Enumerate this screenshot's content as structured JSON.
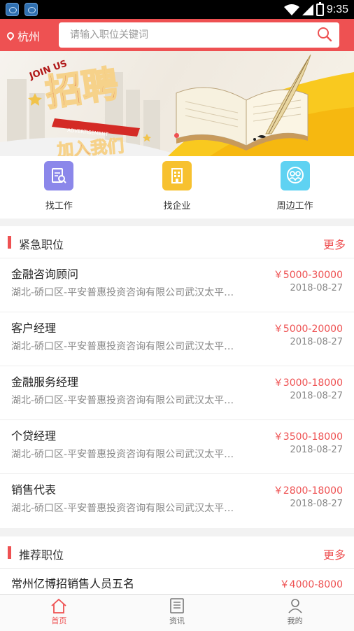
{
  "status_bar": {
    "time": "9:35",
    "app_icons": [
      "app-notification-icon",
      "app-notification-icon"
    ]
  },
  "header": {
    "city": "杭州",
    "search_placeholder": "请输入职位关键词",
    "accent_color": "#ee5152"
  },
  "banner": {
    "headline": "招聘",
    "subline": "加入我们",
    "ribbon_text": "ADVERTISEMENT",
    "small_text": "JOIN US",
    "slide_count": 1,
    "active_slide": 1
  },
  "quick_actions": [
    {
      "label": "找工作",
      "icon": "document-search-icon",
      "color": "#8b87ea"
    },
    {
      "label": "找企业",
      "icon": "building-icon",
      "color": "#f7c12f"
    },
    {
      "label": "周边工作",
      "icon": "nearby-people-icon",
      "color": "#5fd2f2"
    }
  ],
  "urgent": {
    "title": "紧急职位",
    "more": "更多",
    "jobs": [
      {
        "title": "金融咨询顾问",
        "company": "湖北-硚口区-平安普惠投资咨询有限公司武汉太平洋分公司",
        "salary": "￥5000-30000",
        "date": "2018-08-27"
      },
      {
        "title": "客户经理",
        "company": "湖北-硚口区-平安普惠投资咨询有限公司武汉太平洋分公司",
        "salary": "￥5000-20000",
        "date": "2018-08-27"
      },
      {
        "title": "金融服务经理",
        "company": "湖北-硚口区-平安普惠投资咨询有限公司武汉太平洋分公司",
        "salary": "￥3000-18000",
        "date": "2018-08-27"
      },
      {
        "title": "个贷经理",
        "company": "湖北-硚口区-平安普惠投资咨询有限公司武汉太平洋分公司",
        "salary": "￥3500-18000",
        "date": "2018-08-27"
      },
      {
        "title": "销售代表",
        "company": "湖北-硚口区-平安普惠投资咨询有限公司武汉太平洋分公司",
        "salary": "￥2800-18000",
        "date": "2018-08-27"
      }
    ]
  },
  "recommended": {
    "title": "推荐职位",
    "more": "更多",
    "jobs": [
      {
        "title": "常州亿博招销售人员五名",
        "salary": "￥4000-8000"
      }
    ]
  },
  "tabbar": [
    {
      "label": "首页",
      "icon": "home-icon",
      "active": true
    },
    {
      "label": "资讯",
      "icon": "news-icon",
      "active": false
    },
    {
      "label": "我的",
      "icon": "profile-icon",
      "active": false
    }
  ]
}
